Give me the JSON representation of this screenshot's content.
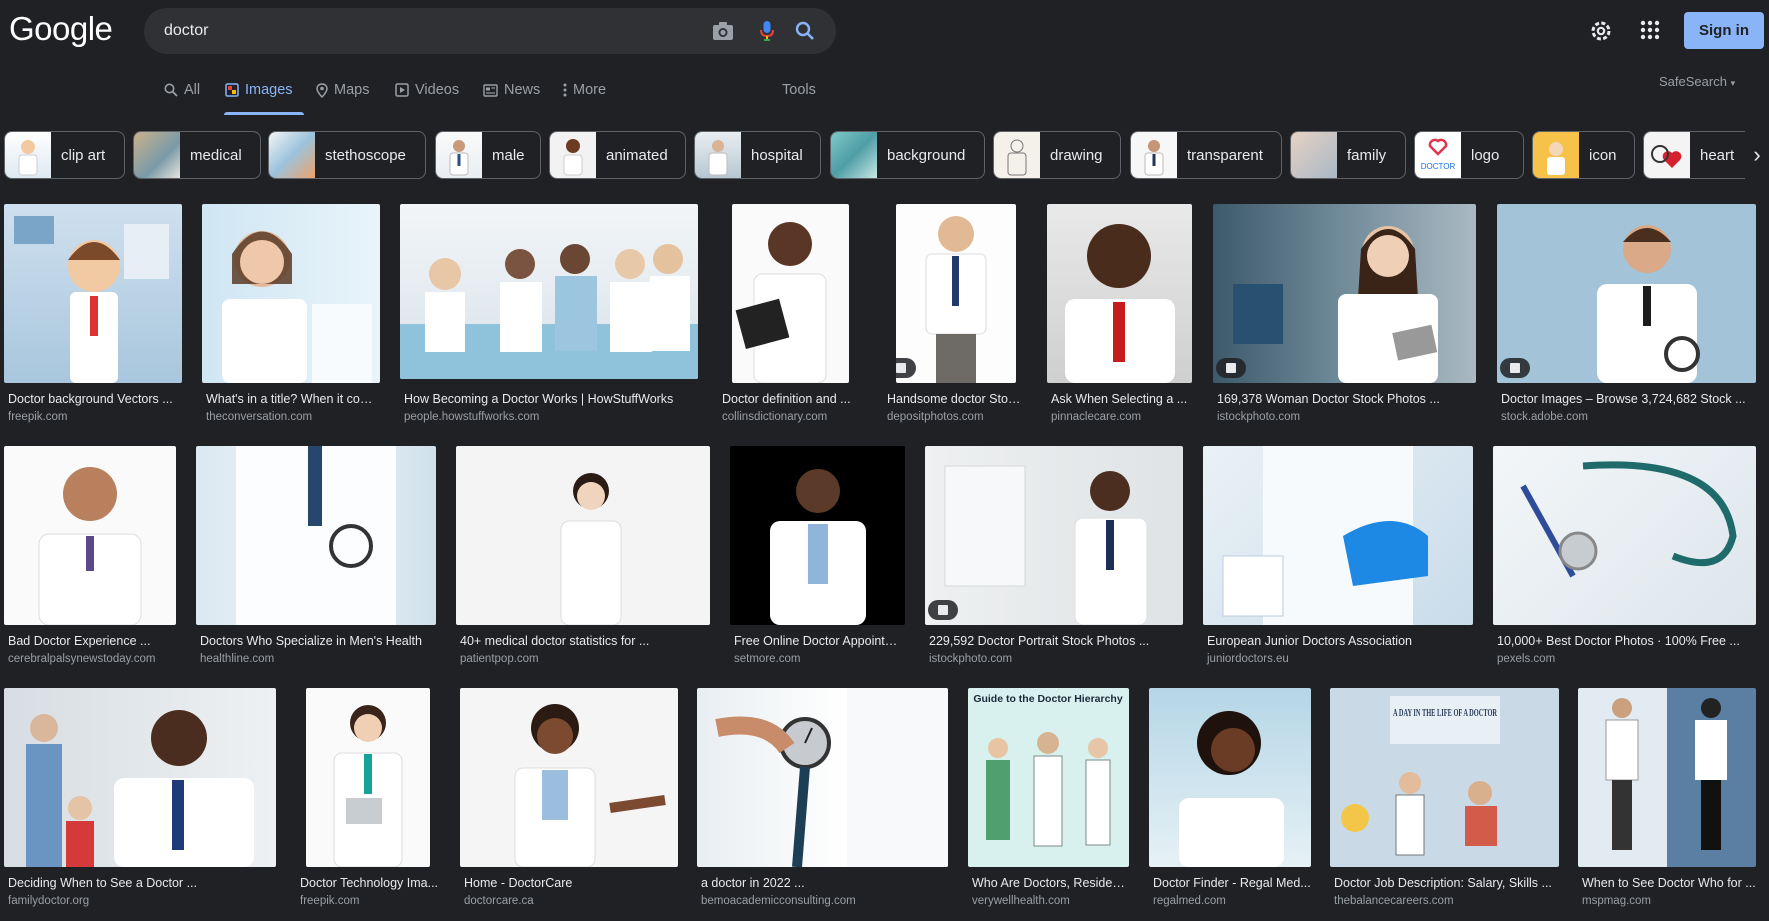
{
  "header": {
    "logo": "Google",
    "query": "doctor",
    "sign_in": "Sign in",
    "icons": [
      "camera-icon",
      "microphone-icon",
      "search-icon",
      "settings-gear-icon",
      "apps-grid-icon"
    ]
  },
  "tabs": [
    {
      "label": "All",
      "icon": "search-icon"
    },
    {
      "label": "Images",
      "icon": "image-icon"
    },
    {
      "label": "Maps",
      "icon": "map-pin-icon"
    },
    {
      "label": "Videos",
      "icon": "video-play-icon"
    },
    {
      "label": "News",
      "icon": "newspaper-icon"
    },
    {
      "label": "More",
      "icon": "more-vert-icon"
    },
    {
      "label": "Tools"
    }
  ],
  "safesearch": "SafeSearch",
  "chips": [
    {
      "label": "clip art"
    },
    {
      "label": "medical"
    },
    {
      "label": "stethoscope"
    },
    {
      "label": "male"
    },
    {
      "label": "animated"
    },
    {
      "label": "hospital"
    },
    {
      "label": "background"
    },
    {
      "label": "drawing"
    },
    {
      "label": "transparent"
    },
    {
      "label": "family"
    },
    {
      "label": "logo"
    },
    {
      "label": "icon"
    },
    {
      "label": "heart"
    }
  ],
  "results": [
    {
      "title": "Doctor background Vectors ...",
      "source": "freepik.com"
    },
    {
      "title": "What's in a title? When it com...",
      "source": "theconversation.com"
    },
    {
      "title": "How Becoming a Doctor Works | HowStuffWorks",
      "source": "people.howstuffworks.com"
    },
    {
      "title": "Doctor definition and ...",
      "source": "collinsdictionary.com"
    },
    {
      "title": "Handsome doctor Stoc...",
      "source": "depositphotos.com"
    },
    {
      "title": "Ask When Selecting a ...",
      "source": "pinnaclecare.com"
    },
    {
      "title": "169,378 Woman Doctor Stock Photos ...",
      "source": "istockphoto.com"
    },
    {
      "title": "Doctor Images – Browse 3,724,682 Stock ...",
      "source": "stock.adobe.com"
    },
    {
      "title": "Bad Doctor Experience ...",
      "source": "cerebralpalsynewstoday.com"
    },
    {
      "title": "Doctors Who Specialize in Men's Health",
      "source": "healthline.com"
    },
    {
      "title": "40+ medical doctor statistics for ...",
      "source": "patientpop.com"
    },
    {
      "title": "Free Online Doctor Appointm...",
      "source": "setmore.com"
    },
    {
      "title": "229,592 Doctor Portrait Stock Photos ...",
      "source": "istockphoto.com"
    },
    {
      "title": "European Junior Doctors Association",
      "source": "juniordoctors.eu"
    },
    {
      "title": "10,000+ Best Doctor Photos · 100% Free ...",
      "source": "pexels.com"
    },
    {
      "title": "Deciding When to See a Doctor ...",
      "source": "familydoctor.org"
    },
    {
      "title": "Doctor Technology Ima...",
      "source": "freepik.com"
    },
    {
      "title": "Home - DoctorCare",
      "source": "doctorcare.ca"
    },
    {
      "title": "a doctor in 2022 ...",
      "source": "bemoacademicconsulting.com"
    },
    {
      "title": "Who Are Doctors, Residen...",
      "source": "verywellhealth.com"
    },
    {
      "title": "Doctor Finder - Regal Med...",
      "source": "regalmed.com"
    },
    {
      "title": "Doctor Job Description: Salary, Skills ...",
      "source": "thebalancecareers.com"
    },
    {
      "title": "When to See Doctor Who for ...",
      "source": "mspmag.com"
    }
  ],
  "image_text": {
    "hierarchy": "Guide to the Doctor Hierarchy",
    "day_life": "A DAY IN THE LIFE OF A DOCTOR",
    "logo_chip": "DOCTOR"
  }
}
